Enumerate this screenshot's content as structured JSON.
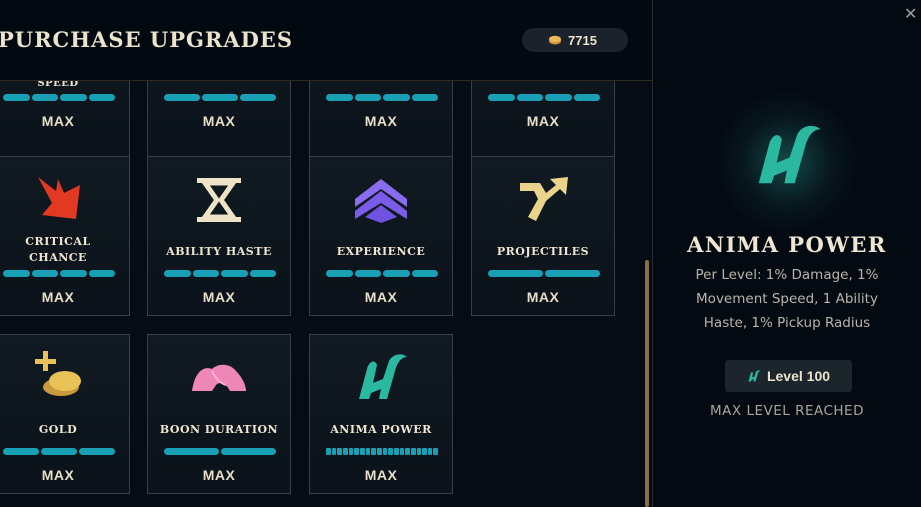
{
  "header": {
    "title": "PURCHASE UPGRADES",
    "currency_icon": "anima-coin-icon",
    "currency_value": "7715"
  },
  "cards": [
    {
      "id": "speed",
      "name": "SPEED",
      "icon": "",
      "status": "MAX",
      "pips": 4
    },
    {
      "id": "top2",
      "name": "",
      "icon": "",
      "status": "MAX",
      "pips": 3
    },
    {
      "id": "top3",
      "name": "",
      "icon": "",
      "status": "MAX",
      "pips": 4
    },
    {
      "id": "top4",
      "name": "",
      "icon": "",
      "status": "MAX",
      "pips": 4
    },
    {
      "id": "crit",
      "name_line1": "CRITICAL",
      "name_line2": "CHANCE",
      "icon": "crit-burst-icon",
      "status": "MAX",
      "pips": 4
    },
    {
      "id": "haste",
      "name": "ABILITY HASTE",
      "icon": "hourglass-icon",
      "status": "MAX",
      "pips": 4
    },
    {
      "id": "xp",
      "name": "EXPERIENCE",
      "icon": "chevron-up-icon",
      "status": "MAX",
      "pips": 4
    },
    {
      "id": "proj",
      "name": "PROJECTILES",
      "icon": "split-arrow-icon",
      "status": "MAX",
      "pips": 2
    },
    {
      "id": "gold",
      "name": "GOLD",
      "icon": "plus-gold-icon",
      "status": "MAX",
      "pips": 3
    },
    {
      "id": "boon",
      "name": "BOON DURATION",
      "icon": "pink-boon-icon",
      "status": "MAX",
      "pips": 2
    },
    {
      "id": "anima",
      "name": "ANIMA POWER",
      "icon": "anima-bunny-icon",
      "status": "MAX",
      "pips": 20
    }
  ],
  "detail": {
    "close_icon": "close-icon",
    "icon": "anima-bunny-icon",
    "title": "ANIMA POWER",
    "description": "Per Level: 1% Damage, 1% Movement Speed, 1 Ability Haste, 1% Pickup Radius",
    "level_label": "Level 100",
    "status": "MAX LEVEL REACHED"
  },
  "colors": {
    "bar": "#1aa0b4",
    "accent_gold": "#8c6f3c",
    "anima_green": "#2bb8a0"
  }
}
